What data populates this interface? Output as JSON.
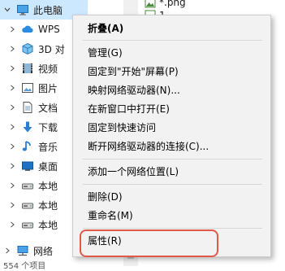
{
  "colors": {
    "selection": "#cce8ff",
    "menu_bg": "#f2f2f2",
    "highlight_border": "#e05a45"
  },
  "file_pane": {
    "file1": "*.png",
    "file2": "1"
  },
  "tree": {
    "root": {
      "label": "此电脑",
      "icon": "computer-icon"
    },
    "items": [
      {
        "label": "WPS",
        "icon": "wps-cloud-icon"
      },
      {
        "label": "3D 对",
        "icon": "3d-objects-icon"
      },
      {
        "label": "视频",
        "icon": "video-icon"
      },
      {
        "label": "图片",
        "icon": "picture-icon"
      },
      {
        "label": "文档",
        "icon": "document-icon"
      },
      {
        "label": "下载",
        "icon": "download-icon"
      },
      {
        "label": "音乐",
        "icon": "music-icon"
      },
      {
        "label": "桌面",
        "icon": "desktop-icon"
      },
      {
        "label": "本地",
        "icon": "drive-icon"
      },
      {
        "label": "本地",
        "icon": "drive-icon"
      },
      {
        "label": "本地",
        "icon": "drive-icon"
      }
    ],
    "network": {
      "label": "网络",
      "icon": "network-icon"
    }
  },
  "status": "554 个项目",
  "context_menu": {
    "items": [
      {
        "label": "折叠(A)",
        "bold": true
      },
      {
        "label": "管理(G)"
      },
      {
        "label": "固定到\"开始\"屏幕(P)"
      },
      {
        "label": "映射网络驱动器(N)..."
      },
      {
        "label": "在新窗口中打开(E)"
      },
      {
        "label": "固定到快速访问"
      },
      {
        "label": "断开网络驱动器的连接(C)..."
      },
      {
        "label": "添加一个网络位置(L)"
      },
      {
        "label": "删除(D)"
      },
      {
        "label": "重命名(M)"
      },
      {
        "label": "属性(R)"
      }
    ]
  }
}
